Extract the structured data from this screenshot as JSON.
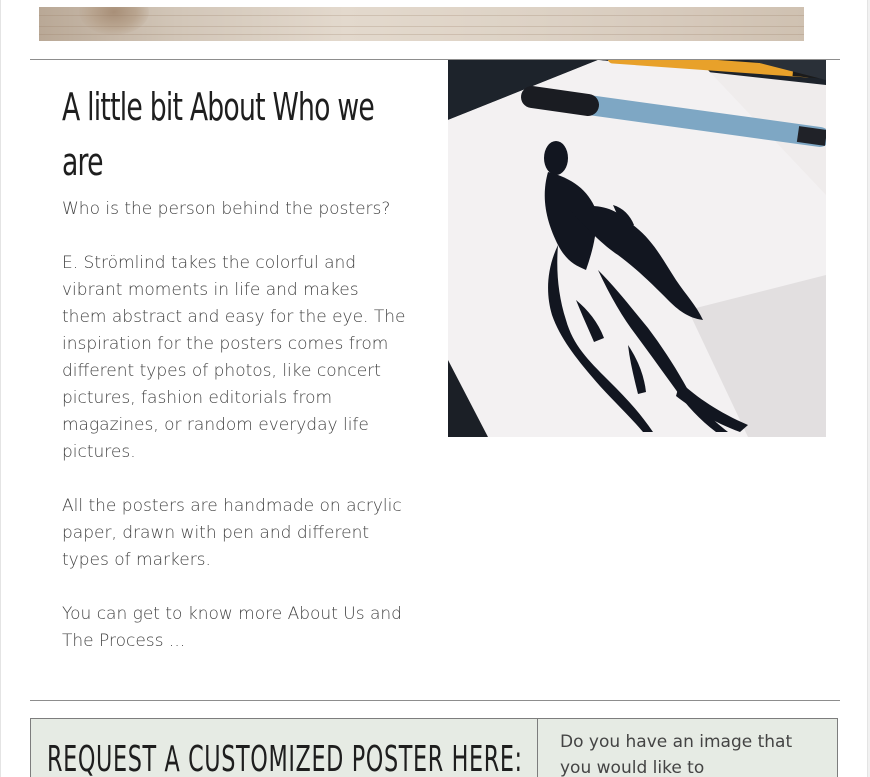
{
  "about": {
    "heading": "A little bit About Who we are",
    "intro": "Who is the person behind the posters?",
    "paragraph1": "E. Strömlind takes the colorful and vibrant moments in life and makes them abstract and easy for the eye. The inspiration for the posters comes from different types of photos, like concert pictures, fashion editorials from magazines, or random everyday life pictures.",
    "paragraph2": "All the posters are handmade on acrylic paper, drawn with pen and different types of markers.",
    "paragraph3": "You can get to know more About Us and The Process ..."
  },
  "request": {
    "heading": "Request a Customized Poster here:",
    "side_text": "Do you have an image that you would like to"
  },
  "colors": {
    "page_background": "#ffffff",
    "text": "#444444",
    "heading": "#1e1e1e",
    "request_background": "#e6ebe4",
    "rule": "#8d8d8d"
  },
  "images": {
    "hero_strip": "wood-texture-banner",
    "about_image": "ink-figure-drawing-with-markers"
  }
}
